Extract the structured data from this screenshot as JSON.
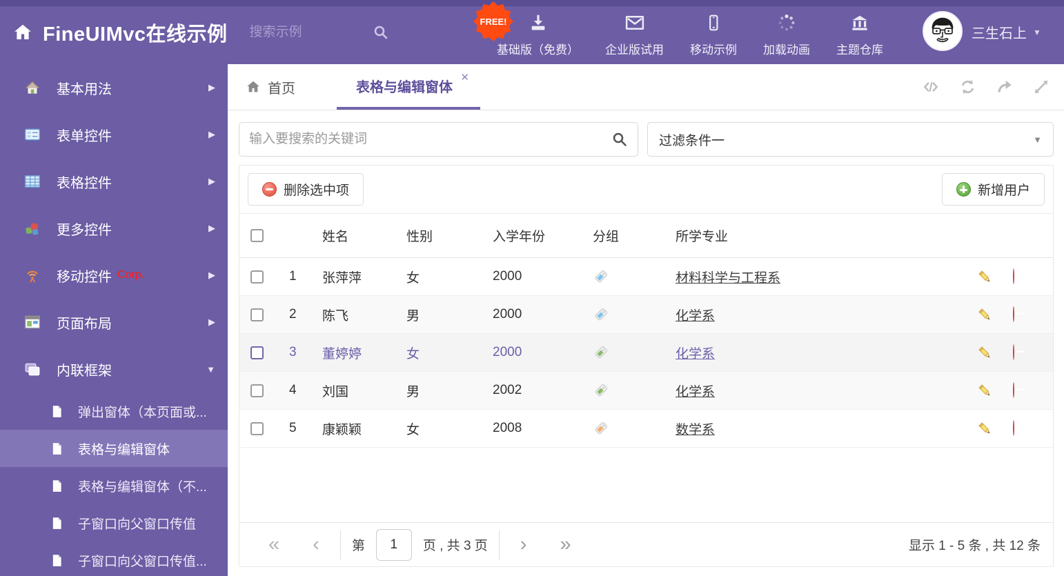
{
  "header": {
    "title": "FineUIMvc在线示例",
    "search_placeholder": "搜索示例",
    "free_badge": "FREE!",
    "nav_items": [
      {
        "icon": "download-icon",
        "label": "基础版（免费）"
      },
      {
        "icon": "envelope-icon",
        "label": "企业版试用"
      },
      {
        "icon": "mobile-icon",
        "label": "移动示例"
      },
      {
        "icon": "spinner-icon",
        "label": "加载动画"
      },
      {
        "icon": "bank-icon",
        "label": "主题仓库"
      }
    ],
    "user": {
      "name": "三生石上"
    }
  },
  "sidebar": {
    "items": [
      {
        "label": "基本用法"
      },
      {
        "label": "表单控件"
      },
      {
        "label": "表格控件"
      },
      {
        "label": "更多控件"
      },
      {
        "label": "移动控件",
        "badge": "Corp."
      },
      {
        "label": "页面布局"
      },
      {
        "label": "内联框架",
        "expanded": true
      }
    ],
    "subitems": [
      {
        "label": "弹出窗体（本页面或..."
      },
      {
        "label": "表格与编辑窗体",
        "selected": true
      },
      {
        "label": "表格与编辑窗体（不..."
      },
      {
        "label": "子窗口向父窗口传值"
      },
      {
        "label": "子窗口向父窗口传值..."
      }
    ]
  },
  "tabs": [
    {
      "label": "首页"
    },
    {
      "label": "表格与编辑窗体",
      "active": true,
      "closable": true
    }
  ],
  "filters": {
    "search_placeholder": "输入要搜索的关键词",
    "dropdown_value": "过滤条件一"
  },
  "toolbar": {
    "delete_selected_label": "删除选中项",
    "add_user_label": "新增用户"
  },
  "table": {
    "columns": [
      "姓名",
      "性别",
      "入学年份",
      "分组",
      "所学专业"
    ],
    "rows": [
      {
        "index": "1",
        "name": "张萍萍",
        "gender": "女",
        "year": "2000",
        "tag_color": "blue",
        "major": "材料科学与工程系",
        "selected": false
      },
      {
        "index": "2",
        "name": "陈飞",
        "gender": "男",
        "year": "2000",
        "tag_color": "blue",
        "major": "化学系",
        "selected": false
      },
      {
        "index": "3",
        "name": "董婷婷",
        "gender": "女",
        "year": "2000",
        "tag_color": "green",
        "major": "化学系",
        "selected": true
      },
      {
        "index": "4",
        "name": "刘国",
        "gender": "男",
        "year": "2002",
        "tag_color": "green",
        "major": "化学系",
        "selected": false
      },
      {
        "index": "5",
        "name": "康颖颖",
        "gender": "女",
        "year": "2008",
        "tag_color": "orange",
        "major": "数学系",
        "selected": false
      }
    ]
  },
  "pagination": {
    "page_prefix": "第",
    "current_page": "1",
    "page_suffix": "页 , 共 3 页",
    "summary": "显示 1 - 5 条 , 共 12 条"
  },
  "colors": {
    "accent_purple": "#6c5da4",
    "sidebar_selected": "#8376b7",
    "free_badge_orange": "#ff4a12",
    "delete_red": "#e04a38",
    "add_green": "#4fa332",
    "tag_blue": "#7ec3f0",
    "tag_green": "#8bbb6a",
    "tag_orange": "#f5ae6e"
  }
}
